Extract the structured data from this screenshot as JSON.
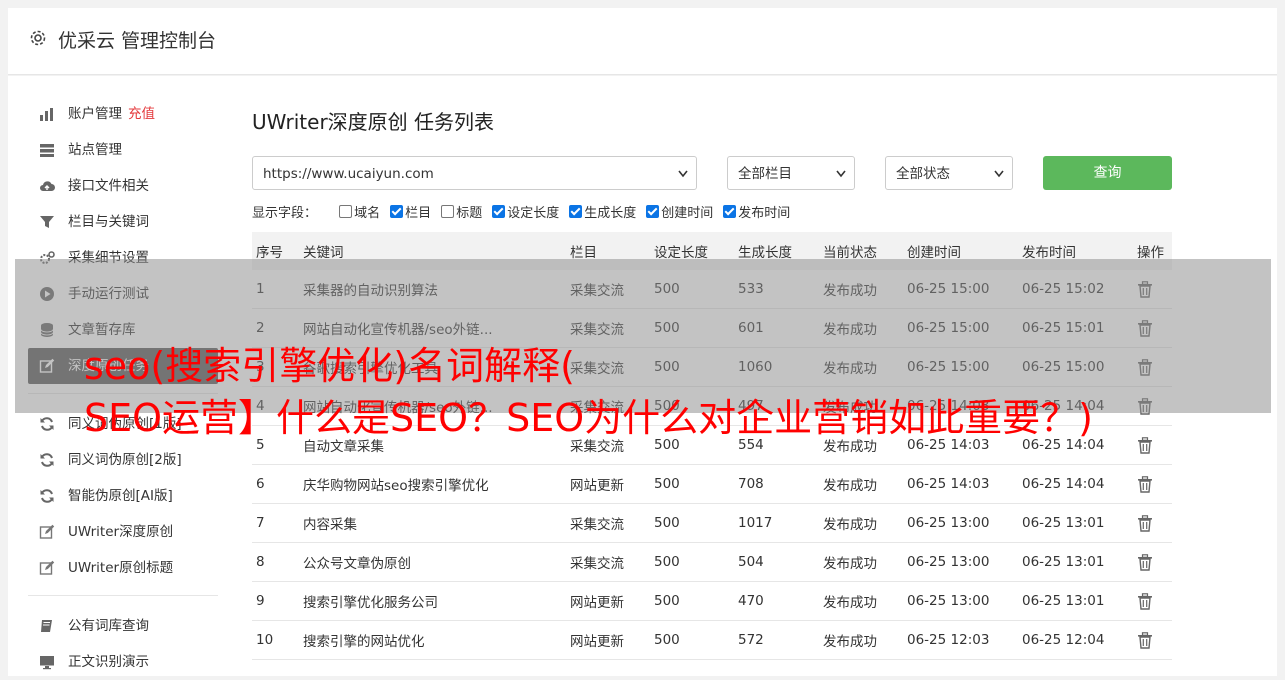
{
  "header": {
    "title": "优采云 管理控制台"
  },
  "sidebar": {
    "items": [
      {
        "label": "账户管理",
        "badge": "充值",
        "icon": "bar-chart-icon"
      },
      {
        "label": "站点管理",
        "icon": "server-icon"
      },
      {
        "label": "接口文件相关",
        "icon": "cloud-upload-icon"
      },
      {
        "label": "栏目与关键词",
        "icon": "filter-icon"
      },
      {
        "label": "采集细节设置",
        "icon": "cogs-icon"
      },
      {
        "label": "手动运行测试",
        "icon": "play-circle-icon"
      },
      {
        "label": "文章暂存库",
        "icon": "database-icon"
      },
      {
        "label": "深度原创任务",
        "icon": "edit-icon",
        "active": true
      }
    ],
    "items2": [
      {
        "label": "同义词伪原创[1版]",
        "icon": "refresh-icon"
      },
      {
        "label": "同义词伪原创[2版]",
        "icon": "refresh-icon"
      },
      {
        "label": "智能伪原创[AI版]",
        "icon": "refresh-icon"
      },
      {
        "label": "UWriter深度原创",
        "icon": "edit-icon"
      },
      {
        "label": "UWriter原创标题",
        "icon": "edit-icon"
      }
    ],
    "items3": [
      {
        "label": "公有词库查询",
        "icon": "book-icon"
      },
      {
        "label": "正文识别演示",
        "icon": "monitor-icon"
      }
    ]
  },
  "main": {
    "title": "UWriter深度原创 任务列表",
    "site_select": "https://www.ucaiyun.com",
    "column_select": "全部栏目",
    "status_select": "全部状态",
    "query_label": "查询",
    "fields_label": "显示字段：",
    "fields": [
      {
        "label": "域名",
        "checked": false
      },
      {
        "label": "栏目",
        "checked": true
      },
      {
        "label": "标题",
        "checked": false
      },
      {
        "label": "设定长度",
        "checked": true
      },
      {
        "label": "生成长度",
        "checked": true
      },
      {
        "label": "创建时间",
        "checked": true
      },
      {
        "label": "发布时间",
        "checked": true
      }
    ],
    "columns": [
      "序号",
      "关键词",
      "栏目",
      "设定长度",
      "生成长度",
      "当前状态",
      "创建时间",
      "发布时间",
      "操作"
    ],
    "rows": [
      [
        "1",
        "采集器的自动识别算法",
        "采集交流",
        "500",
        "533",
        "发布成功",
        "06-25 15:00",
        "06-25 15:02"
      ],
      [
        "2",
        "网站自动化宣传机器/seo外链...",
        "采集交流",
        "500",
        "601",
        "发布成功",
        "06-25 15:00",
        "06-25 15:01"
      ],
      [
        "3",
        "谷歌搜索引擎优化工具",
        "采集交流",
        "500",
        "1060",
        "发布成功",
        "06-25 15:00",
        "06-25 15:00"
      ],
      [
        "4",
        "网站自动化宣传机器/seo外链...",
        "采集交流",
        "500",
        "497",
        "发布成功",
        "06-25 14:03",
        "06-25 14:04"
      ],
      [
        "5",
        "自动文章采集",
        "采集交流",
        "500",
        "554",
        "发布成功",
        "06-25 14:03",
        "06-25 14:04"
      ],
      [
        "6",
        "庆华购物网站seo搜索引擎优化",
        "网站更新",
        "500",
        "708",
        "发布成功",
        "06-25 14:03",
        "06-25 14:04"
      ],
      [
        "7",
        "内容采集",
        "采集交流",
        "500",
        "1017",
        "发布成功",
        "06-25 13:00",
        "06-25 13:01"
      ],
      [
        "8",
        "公众号文章伪原创",
        "采集交流",
        "500",
        "504",
        "发布成功",
        "06-25 13:00",
        "06-25 13:01"
      ],
      [
        "9",
        "搜索引擎优化服务公司",
        "网站更新",
        "500",
        "470",
        "发布成功",
        "06-25 13:00",
        "06-25 13:01"
      ],
      [
        "10",
        "搜索引擎的网站优化",
        "网站更新",
        "500",
        "572",
        "发布成功",
        "06-25 12:03",
        "06-25 12:04"
      ]
    ]
  },
  "overlay": {
    "line1": "seo(搜索引擎优化)名词解释(",
    "line2": "SEO运营】什么是SEO？SEO为什么对企业营销如此重要？)"
  },
  "colors": {
    "success": "#2e9e2e",
    "query": "#5cb85c",
    "active_nav": "#5b5b5b",
    "overlay_text": "#ff0000"
  }
}
